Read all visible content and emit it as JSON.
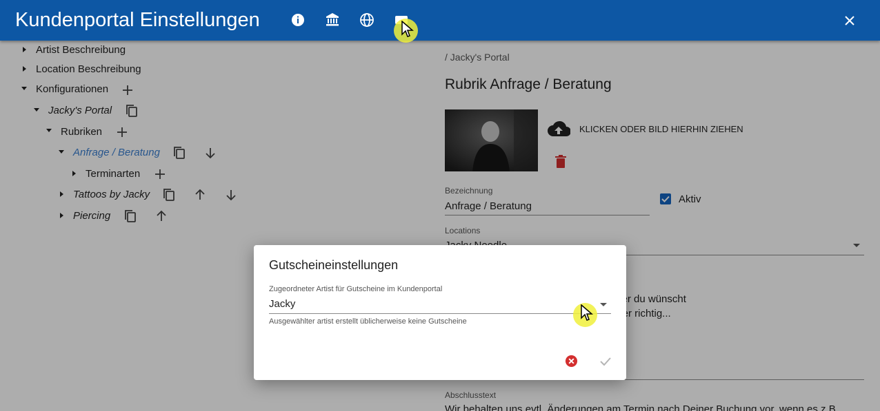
{
  "header": {
    "title": "Kundenportal Einstellungen",
    "icons": [
      "info-icon",
      "bank-icon",
      "globe-icon",
      "voucher-icon"
    ],
    "close_icon": "close-icon"
  },
  "tree": {
    "items": [
      {
        "label": "Artist Beschreibung"
      },
      {
        "label": "Location Beschreibung"
      },
      {
        "label": "Konfigurationen"
      },
      {
        "label": "Jacky's Portal"
      },
      {
        "label": "Rubriken"
      },
      {
        "label": "Anfrage / Beratung"
      },
      {
        "label": "Terminarten"
      },
      {
        "label": "Tattoos by Jacky"
      },
      {
        "label": "Piercing"
      }
    ]
  },
  "detail": {
    "breadcrumb": "/ Jacky's Portal",
    "title": "Rubrik Anfrage / Beratung",
    "upload_label": "KLICKEN ODER BILD HIERHIN ZIEHEN",
    "bezeichnung_label": "Bezeichnung",
    "bezeichnung_value": "Anfrage / Beratung",
    "aktiv_label": "Aktiv",
    "aktiv_checked": true,
    "locations_label": "Locations",
    "locations_value": "Jacky Needle",
    "description_line1": "e zu Deinem Wunsch-Tattoo stellen oder du wünscht",
    "description_line2": "oder bei uns im Studio? Dann bis du hier richtig...",
    "abschluss_label": "Abschlusstext",
    "abschluss_value": "Wir behalten uns evtl. Änderungen am Termin nach Deiner Buchung vor, wenn es z.B."
  },
  "dialog": {
    "title": "Gutscheineinstellungen",
    "field_label": "Zugeordneter Artist für Gutscheine im Kundenportal",
    "field_value": "Jacky",
    "hint": "Ausgewählter artist erstellt üblicherweise keine Gutscheine"
  },
  "colors": {
    "header_bg": "#0d57a4",
    "selected_text": "#3b7fd0",
    "delete_red": "#d32f2f",
    "checkbox_blue": "#1565c0"
  }
}
